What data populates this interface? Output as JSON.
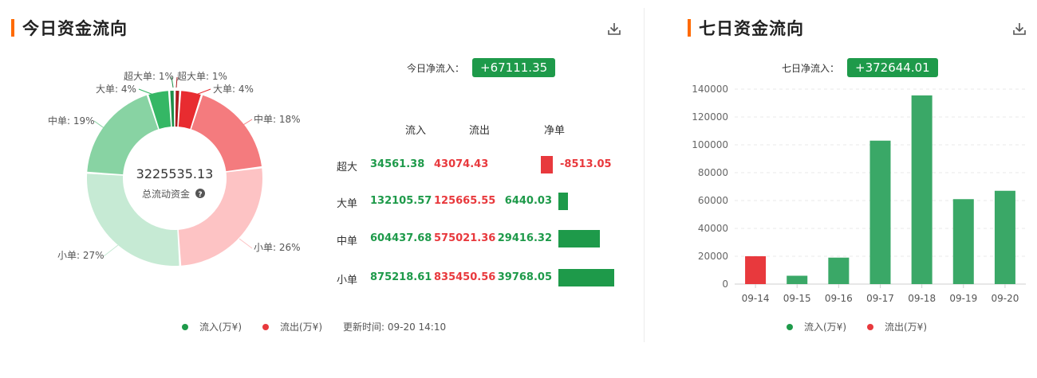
{
  "today": {
    "title": "今日资金流向",
    "net_label": "今日净流入：",
    "net_value": "+67111.35",
    "donut": {
      "center_value": "3225535.13",
      "center_label": "总流动资金"
    },
    "table": {
      "headers": {
        "in": "流入",
        "out": "流出",
        "net": "净单"
      },
      "rows": [
        {
          "label": "超大",
          "in": "34561.38",
          "out": "43074.43",
          "net": "-8513.05"
        },
        {
          "label": "大单",
          "in": "132105.57",
          "out": "125665.55",
          "net": "6440.03"
        },
        {
          "label": "中单",
          "in": "604437.68",
          "out": "575021.36",
          "net": "29416.32"
        },
        {
          "label": "小单",
          "in": "875218.61",
          "out": "835450.56",
          "net": "39768.05"
        }
      ]
    },
    "legend": {
      "inflow": "流入(万¥)",
      "outflow": "流出(万¥)",
      "update": "更新时间: 09-20 14:10"
    }
  },
  "week": {
    "title": "七日资金流向",
    "net_label": "七日净流入：",
    "net_value": "+372644.01",
    "legend": {
      "inflow": "流入(万¥)",
      "outflow": "流出(万¥)"
    }
  },
  "colors": {
    "accent": "#ff6a00",
    "green": "#1e9a4a",
    "green_bar": "#3aa867",
    "red": "#e8393d"
  },
  "chart_data": [
    {
      "type": "pie",
      "slices": [
        {
          "label": "超大单",
          "value": 1,
          "flow": "in",
          "color": "#1e8f49"
        },
        {
          "label": "大单",
          "value": 4,
          "flow": "in",
          "color": "#35b765"
        },
        {
          "label": "中单",
          "value": 19,
          "flow": "in",
          "color": "#88d3a3"
        },
        {
          "label": "小单",
          "value": 27,
          "flow": "in",
          "color": "#c6ead4"
        },
        {
          "label": "小单",
          "value": 26,
          "flow": "out",
          "color": "#fdc3c4"
        },
        {
          "label": "中单",
          "value": 18,
          "flow": "out",
          "color": "#f47b7e"
        },
        {
          "label": "大单",
          "value": 4,
          "flow": "out",
          "color": "#e82c30"
        },
        {
          "label": "超大单",
          "value": 1,
          "flow": "out",
          "color": "#a81c1f"
        }
      ],
      "labels": [
        {
          "text": "超大单: 1%"
        },
        {
          "text": "超大单: 1%"
        },
        {
          "text": "大单: 4%"
        },
        {
          "text": "大单: 4%"
        },
        {
          "text": "中单: 19%"
        },
        {
          "text": "中单: 18%"
        },
        {
          "text": "小单: 27%"
        },
        {
          "text": "小单: 26%"
        }
      ]
    },
    {
      "type": "bar",
      "title": "",
      "values": [
        -8513.05,
        6440.03,
        29416.32,
        39768.05
      ]
    },
    {
      "type": "bar",
      "categories": [
        "09-14",
        "09-15",
        "09-16",
        "09-17",
        "09-18",
        "09-19",
        "09-20"
      ],
      "values": [
        20000,
        6000,
        19000,
        103000,
        135500,
        61000,
        67000
      ],
      "signs": [
        "out",
        "in",
        "in",
        "in",
        "in",
        "in",
        "in"
      ],
      "ylim": [
        0,
        140000
      ],
      "yticks": [
        "0",
        "20000",
        "40000",
        "60000",
        "80000",
        "100000",
        "120000",
        "140000"
      ],
      "grid": true
    }
  ]
}
